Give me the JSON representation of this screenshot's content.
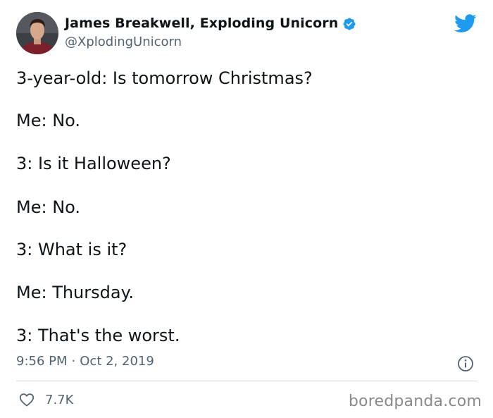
{
  "author": {
    "display_name": "James Breakwell, Exploding Unicorn",
    "handle": "@XplodingUnicorn",
    "verified": true,
    "avatar_icon": "user-avatar-photo"
  },
  "brand": {
    "icon": "twitter-bird-icon",
    "color": "#1d9bf0"
  },
  "tweet": {
    "lines": [
      "3-year-old: Is tomorrow Christmas?",
      "Me: No.",
      "3: Is it Halloween?",
      "Me: No.",
      "3: What is it?",
      "Me: Thursday.",
      "3: That's the worst."
    ]
  },
  "meta": {
    "time": "9:56 PM",
    "separator": "·",
    "date": "Oct 2, 2019",
    "info_icon": "info-icon"
  },
  "engagement": {
    "like_icon": "heart-icon",
    "likes": "7.7K"
  },
  "watermark": "boredpanda.com"
}
